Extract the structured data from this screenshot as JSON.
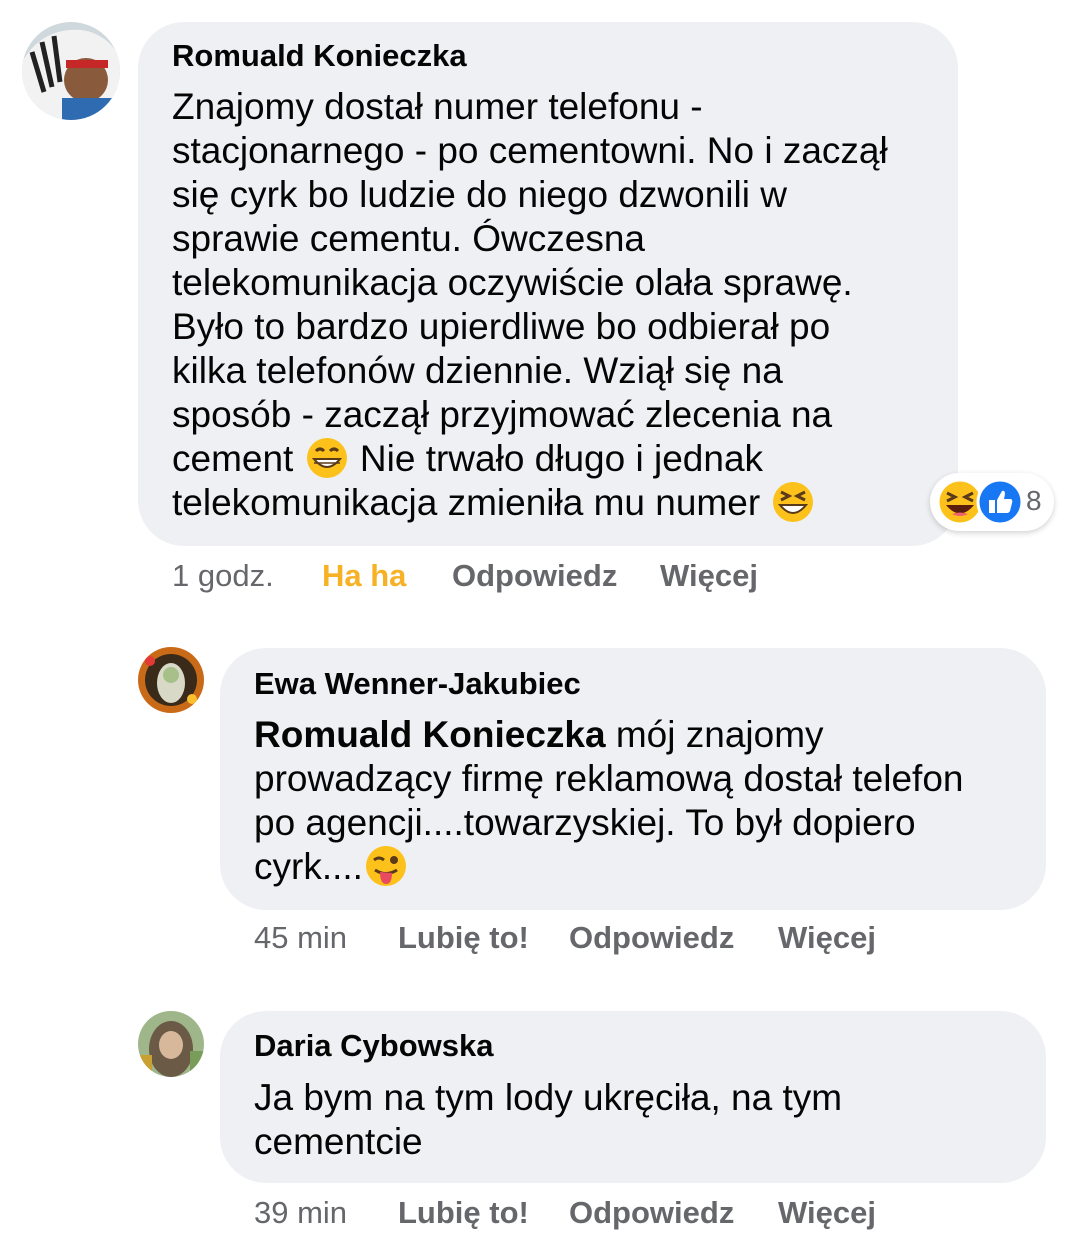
{
  "comments": [
    {
      "author": "Romuald Konieczka",
      "text_lines": [
        "Znajomy dostał numer telefonu -",
        "stacjonarnego - po cementowni. No i zaczął",
        "się cyrk bo ludzie do niego dzwonili w",
        "sprawie cementu. Ówczesna",
        "telekomunikacja oczywiście olała sprawę.",
        "Było to bardzo upierdliwe bo odbierał po",
        "kilka telefonów dziennie. Wziął się na",
        "sposób - zaczął przyjmować zlecenia na"
      ],
      "line9_before": "cement",
      "line9_after": "Nie trwało długo i jednak",
      "line10": "telekomunikacja zmieniła mu numer",
      "emoji_1": "grinning-face-emoji",
      "emoji_2": "laughing-squint-emoji",
      "reactions": {
        "icons": [
          "haha-reaction-icon",
          "like-reaction-icon"
        ],
        "count": "8"
      },
      "time": "1 godz.",
      "like_label": "Ha ha",
      "reply_label": "Odpowiedz",
      "more_label": "Więcej"
    },
    {
      "author": "Ewa Wenner-Jakubiec",
      "mention": "Romuald Konieczka",
      "line1_rest": " mój znajomy",
      "line2": "prowadzący firmę reklamową dostał telefon",
      "line3": "po agencji....towarzyskiej. To był dopiero",
      "line4": "cyrk....",
      "emoji": "winking-tongue-emoji",
      "time": "45 min",
      "like_label": "Lubię to!",
      "reply_label": "Odpowiedz",
      "more_label": "Więcej"
    },
    {
      "author": "Daria Cybowska",
      "line1": "Ja bym na tym lody ukręciła, na tym",
      "line2": "cementcie",
      "time": "39 min",
      "like_label": "Lubię to!",
      "reply_label": "Odpowiedz",
      "more_label": "Więcej"
    }
  ],
  "colors": {
    "bubble": "#eef0f3",
    "meta": "#65676b",
    "haha": "#f7b125",
    "like_blue": "#1877f2"
  }
}
